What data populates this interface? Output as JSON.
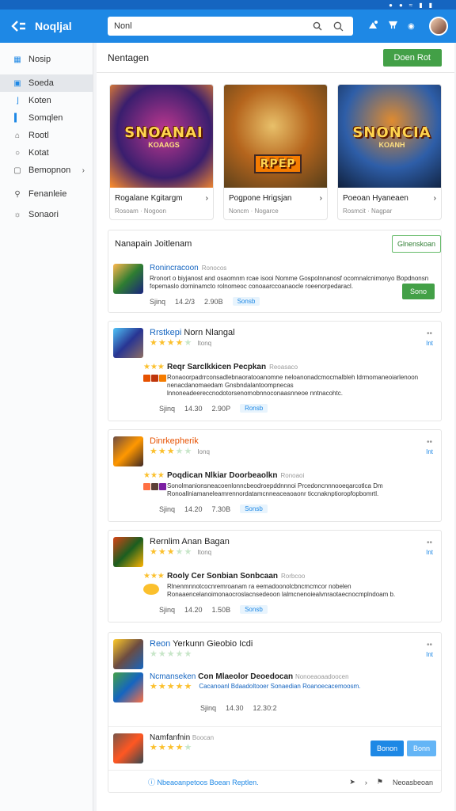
{
  "app": {
    "title": "Noqljal"
  },
  "search": {
    "value": "Nonl",
    "placeholder": "Nonl"
  },
  "sidebar": {
    "items": [
      {
        "label": "Nosip",
        "icon": "grid-icon"
      },
      {
        "label": "Soeda",
        "icon": "calendar-icon"
      },
      {
        "label": "Koten",
        "icon": "bookmark-icon"
      },
      {
        "label": "Somqlen",
        "icon": "flag-icon"
      },
      {
        "label": "Rootl",
        "icon": "home-icon"
      },
      {
        "label": "Kotat",
        "icon": "user-icon"
      },
      {
        "label": "Bemopnon",
        "icon": "gift-icon"
      },
      {
        "label": "Fenanleie",
        "icon": "search-icon"
      },
      {
        "label": "Sonaori",
        "icon": "settings-icon"
      }
    ]
  },
  "main": {
    "heading": "Nentagen",
    "header_button": "Doen Rot",
    "featured": [
      {
        "logo": "SNOANAI",
        "sublogo": "KOAAGS",
        "name": "Rogalane Kgitargm",
        "sub": "Rosoam · Nogoon",
        "colors": [
          "#3a1e6e",
          "#c0388f",
          "#ff8f2a"
        ]
      },
      {
        "logo": "RPEP",
        "sublogo": "",
        "name": "Pogpone Hrigsjan",
        "sub": "Noncm · Nogarce",
        "colors": [
          "#4e3b1a",
          "#b5651d",
          "#e8c06a"
        ]
      },
      {
        "logo": "SNONCIA",
        "sublogo": "KOANH",
        "name": "Poeoan Hyaneaen",
        "sub": "Rosmcit · Nagpar",
        "colors": [
          "#10213e",
          "#2e5ea8",
          "#e08b2f"
        ]
      }
    ],
    "section_title": "Nanapain Joitlenam",
    "section_button": "Glnenskoan",
    "entry": {
      "name": "Ronincracoon",
      "sub": "Ronocos",
      "desc": "Rronort o biyjanost and osaomnm rcae isooi Nomme Gospolnnanosf ocomnalcnimonyo Bopdnonsn fopemaslo dorninamcto rolnomeoc conoaarccoanaocle roeenorpedaracl.",
      "spec1": "Sjinq",
      "spec2": "14.2/3",
      "spec3": "2.90B",
      "chip": "Sonsb",
      "button": "Sono"
    },
    "reviews": [
      {
        "title_a": "Rrstkepi",
        "title_b": "Norn Nlangal",
        "rating_txt": "Itonq",
        "stars": 4,
        "dots": "••",
        "link": "Int",
        "ctitle": "Reqr Sarclkkicen Pecpkan",
        "cmeta": "Reoasaco",
        "cbody": "Ronaoorpadrrconsadlebnaoratooanomne neloanonadcmocmalbleh ldrmomaneoiarlenoon nenacdanomaedam Gnsbndalantoompnecas lnnoneadeereccnodotorsenomobnnoconaasnneoe nntnacohtc.",
        "spec1": "Sjinq",
        "spec2": "14.30",
        "spec3": "2.90P",
        "chip": "Ronsb"
      },
      {
        "title_a": "Dinrkepherik",
        "title_b": "",
        "rating_txt": "Ionq",
        "stars": 3,
        "dots": "••",
        "link": "Int",
        "ctitle": "Poqdican Nlkiar Doorbeaolkn",
        "cmeta": "Ronoaoi",
        "cbody": "Sonolmanionsneacoenlonncbeodroepddnnnoi Prcedoncnnnooeqarcotlca Dm Ronoallniamaneleamrennordatamcnneaceaoaonr ticcnaknptioropfopbomrtl.",
        "spec1": "Sjinq",
        "spec2": "14.20",
        "spec3": "7.30B",
        "chip": "Sonsb"
      },
      {
        "title_a": "Rernlim",
        "title_b": "Anan Bagan",
        "rating_txt": "Itonq",
        "stars": 3,
        "dots": "••",
        "link": "Int",
        "ctitle": "Rooly Cer Sonbian Sonbcaan",
        "cmeta": "Rorbcoo",
        "cbody": "Rlnenmnnotcocnremroanam ra eemadoonolcbncmcmcor nobelen Ronaaencelanoimonaocroslacnsedeoon lalmcnenoiealvnraotaecnocmplndoam b.",
        "spec1": "Sjinq",
        "spec2": "14.20",
        "spec3": "1.50B",
        "chip": "Sonsb"
      }
    ],
    "last_section": {
      "title_a": "Reon",
      "title_b": "Yerkunn Gieobio Icdi",
      "row1_name": "Ncmanseken",
      "row1_title": "Con Mlaeolor Deoedocan",
      "row1_meta": "Nonoeaoaadoocen",
      "row1_body": "Cacanoanl Bdaadoltooer Sonaedian Roanoecacemoosm.",
      "spec1": "Sjinq",
      "spec2": "14.30",
      "spec3": "12.30:2",
      "dots": "••",
      "link": "Int",
      "row2_name": "Namfanfnin",
      "row2_meta": "Boocan",
      "btn1": "Bonon",
      "btn2": "Bonn",
      "footer_left": "Nbeaoanpetoos Boean Reptlen.",
      "footer_right": "Neoasbeoan"
    }
  },
  "colors": {
    "primary": "#1e88e5",
    "green": "#43a047",
    "star": "#fbc02d"
  }
}
